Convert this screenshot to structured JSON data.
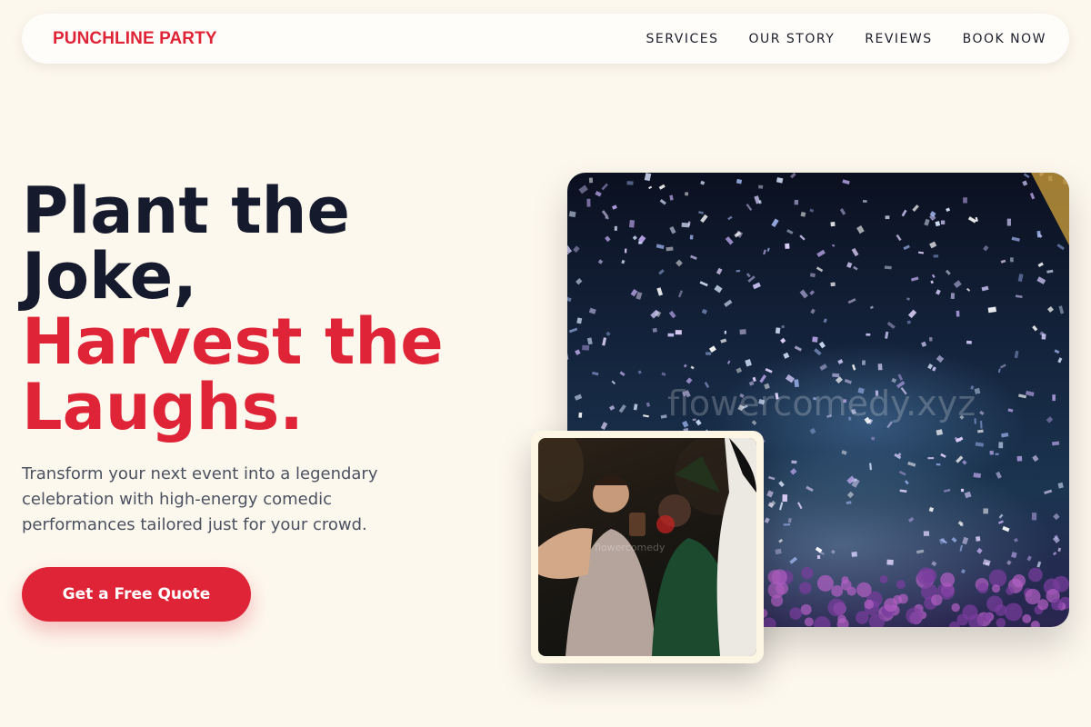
{
  "brand": "PUNCHLINE PARTY",
  "nav": [
    "SERVICES",
    "OUR STORY",
    "REVIEWS",
    "BOOK NOW"
  ],
  "hero": {
    "line1": "Plant the",
    "line2": "Joke,",
    "line3": "Harvest the",
    "line4": "Laughs.",
    "subtext": "Transform your next event into a legendary celebration with high-energy comedic performances tailored just for your crowd.",
    "cta": "Get a Free Quote"
  },
  "images": {
    "main_watermark": "flowercomedy.xyz",
    "inset_watermark": "flowercomedy"
  },
  "colors": {
    "accent": "#e02438",
    "dark": "#151a2d",
    "background": "#fdf8ee"
  }
}
